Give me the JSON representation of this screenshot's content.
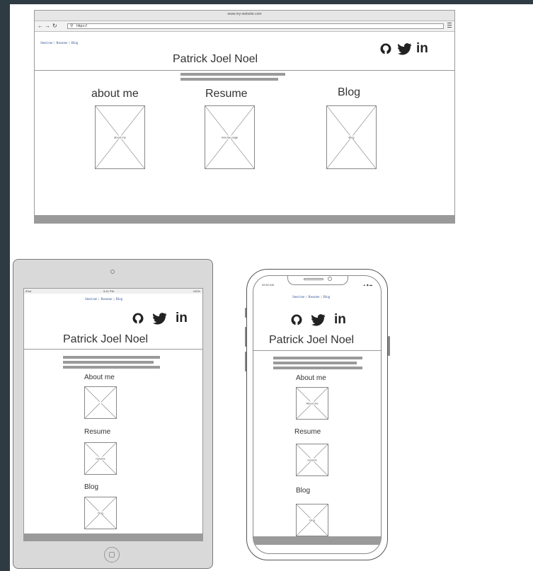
{
  "site": {
    "title": "Patrick Joel Noel",
    "nav": [
      "Steel.me",
      "Resume",
      "Blog"
    ]
  },
  "browser": {
    "window_title": "www.my-website.com",
    "address": "https://",
    "sections": [
      {
        "heading": "about me",
        "image_label": "about me"
      },
      {
        "heading": "Resume",
        "image_label": "resume page"
      },
      {
        "heading": "Blog",
        "image_label": "Blog"
      }
    ]
  },
  "tablet": {
    "status_left": "iPad",
    "status_center": "9:41 PM",
    "status_right": "100%",
    "sections": [
      {
        "heading": "About me",
        "image_label": ""
      },
      {
        "heading": "Resume",
        "image_label": "resume"
      },
      {
        "heading": "Blog",
        "image_label": "blog"
      }
    ]
  },
  "phone": {
    "status_time": "09:52 AM",
    "status_icons": "▲ ◆ ▬",
    "sections": [
      {
        "heading": "About me",
        "image_label": "About me"
      },
      {
        "heading": "Resume",
        "image_label": "resume"
      },
      {
        "heading": "Blog",
        "image_label": "blog"
      }
    ]
  },
  "icons": {
    "github": "github-icon",
    "twitter": "twitter-icon",
    "linkedin": "linkedin-icon",
    "linkedin_text": "in"
  },
  "colors": {
    "frame": "#2f3b43",
    "placeholder_gray": "#9a9a9a",
    "link": "#3a5a9a"
  }
}
